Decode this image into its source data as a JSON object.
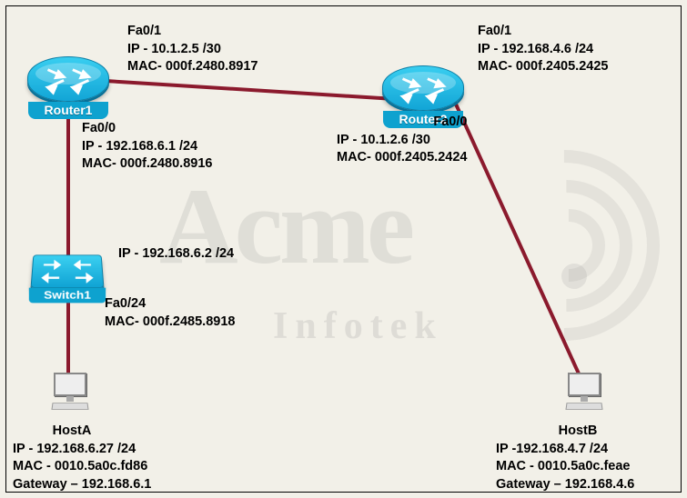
{
  "devices": {
    "router1": {
      "label": "Router1"
    },
    "router2": {
      "label": "Router2"
    },
    "switch1": {
      "label": "Switch1"
    },
    "hostA": {
      "label": "HostA"
    },
    "hostB": {
      "label": "HostB"
    }
  },
  "router1": {
    "fa01": {
      "if": "Fa0/1",
      "ip": "IP - 10.1.2.5 /30",
      "mac": "MAC- 000f.2480.8917"
    },
    "fa00": {
      "if": "Fa0/0",
      "ip": "IP - 192.168.6.1 /24",
      "mac": "MAC- 000f.2480.8916"
    }
  },
  "router2": {
    "fa01": {
      "if": "Fa0/1",
      "ip": "IP - 192.168.4.6 /24",
      "mac": "MAC- 000f.2405.2425"
    },
    "fa00": {
      "if": "Fa0/0",
      "ip": "IP - 10.1.2.6 /30",
      "mac": "MAC- 000f.2405.2424"
    }
  },
  "switch1": {
    "mgmt_ip": "IP - 192.168.6.2 /24",
    "fa024": {
      "if": "Fa0/24",
      "mac": "MAC- 000f.2485.8918"
    }
  },
  "hostA": {
    "name": "HostA",
    "ip": "IP - 192.168.6.27 /24",
    "mac": "MAC - 0010.5a0c.fd86",
    "gw": "Gateway – 192.168.6.1"
  },
  "hostB": {
    "name": "HostB",
    "ip": "IP -192.168.4.7 /24",
    "mac": "MAC - 0010.5a0c.feae",
    "gw": "Gateway – 192.168.4.6"
  },
  "watermark": {
    "brand": "Acme",
    "sub": "Infotek"
  }
}
